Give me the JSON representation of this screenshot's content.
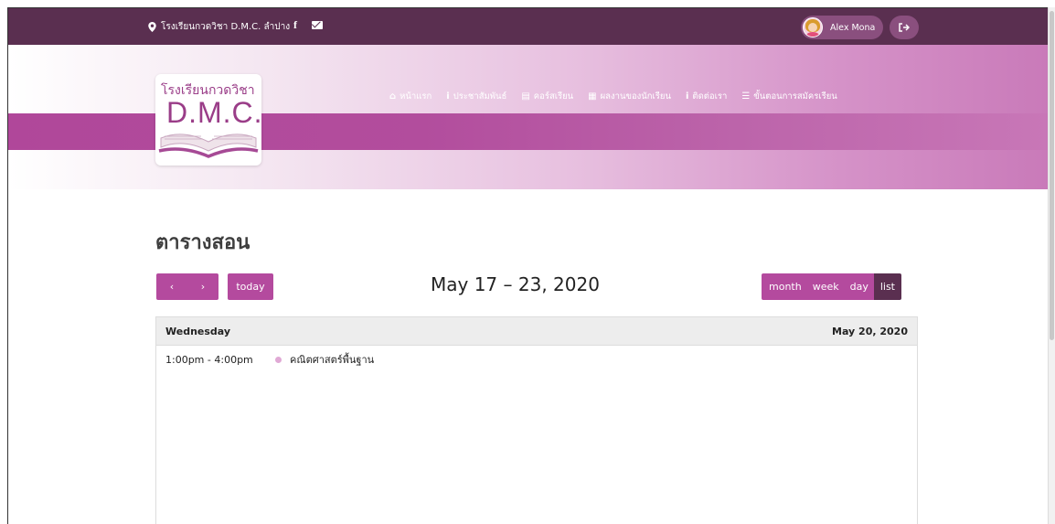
{
  "topbar": {
    "location": "โรงเรียนกวดวิชา D.M.C. ลำปาง",
    "facebook_glyph": "f",
    "user_name": "Alex Mona",
    "logout_icon": "sign-out-icon"
  },
  "logo": {
    "line1": "โรงเรียนกวดวิชา",
    "line2": "D.M.C."
  },
  "nav": {
    "items": [
      {
        "icon": "⌂",
        "label": "หน้าแรก"
      },
      {
        "icon": "i",
        "label": "ประชาสัมพันธ์"
      },
      {
        "icon": "▤",
        "label": "คอร์สเรียน"
      },
      {
        "icon": "▦",
        "label": "ผลงานของนักเรียน"
      },
      {
        "icon": "i",
        "label": "ติดต่อเรา"
      },
      {
        "icon": "☰",
        "label": "ขั้นตอนการสมัครเรียน"
      }
    ]
  },
  "page": {
    "title": "ตารางสอน"
  },
  "calendar": {
    "prev_label": "‹",
    "next_label": "›",
    "today_label": "today",
    "title": "May 17 – 23, 2020",
    "views": {
      "month": "month",
      "week": "week",
      "day": "day",
      "list": "list"
    },
    "active_view": "list",
    "day_header": {
      "weekday": "Wednesday",
      "date": "May 20, 2020"
    },
    "events": [
      {
        "time": "1:00pm - 4:00pm",
        "title": "คณิตศาสตร์พื้นฐาน"
      }
    ]
  },
  "colors": {
    "brand_dark": "#5a2f50",
    "brand": "#b44a9e",
    "event_dot": "#e0a9d5"
  }
}
